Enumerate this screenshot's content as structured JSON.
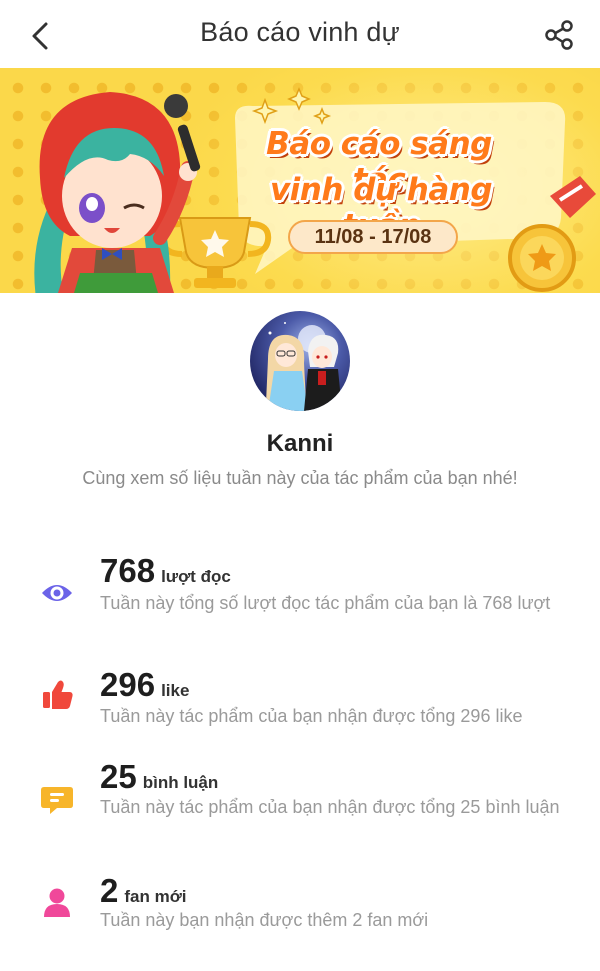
{
  "header": {
    "title": "Báo cáo vinh dự",
    "back_icon": "chevron-left-icon",
    "share_icon": "share-icon"
  },
  "banner": {
    "title_line1": "Báo cáo sáng tác",
    "title_line2": "vinh dự hàng tuần",
    "date_range": "11/08 - 17/08",
    "colors": {
      "background": "#fbd84a",
      "title": "#ff7a1a"
    }
  },
  "profile": {
    "name": "Kanni",
    "subtitle": "Cùng xem số liệu tuần này của tác phẩm của bạn nhé!"
  },
  "stats": [
    {
      "icon": "eye-icon",
      "color": "#6b63e8",
      "value": "768",
      "unit": "lượt đọc",
      "description": "Tuần này tổng số lượt đọc tác phẩm của bạn là 768 lượt"
    },
    {
      "icon": "thumbs-up-icon",
      "color": "#f0483c",
      "value": "296",
      "unit": "like",
      "description": "Tuần này tác phẩm của bạn nhận được tổng 296 like"
    },
    {
      "icon": "comment-icon",
      "color": "#f7b52a",
      "value": "25",
      "unit": "bình luận",
      "description": "Tuần này tác phẩm của bạn nhận được tổng 25 bình luận"
    },
    {
      "icon": "user-icon",
      "color": "#f0489a",
      "value": "2",
      "unit": "fan mới",
      "description": "Tuần này bạn nhận được thêm 2 fan mới"
    }
  ]
}
